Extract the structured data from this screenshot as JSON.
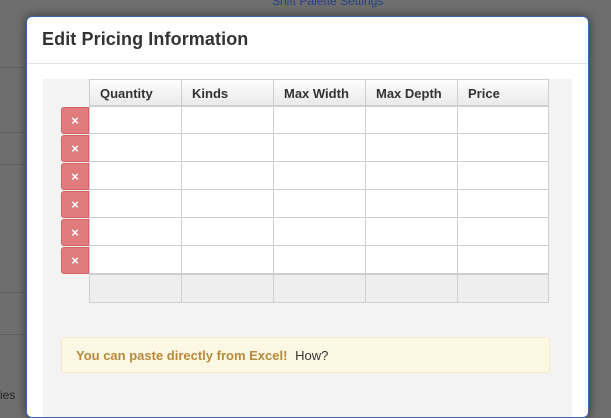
{
  "background": {
    "top_link": "Shift Palette Settings",
    "bottom_text": "ies"
  },
  "modal": {
    "title": "Edit Pricing Information"
  },
  "grid": {
    "columns": [
      "Quantity",
      "Kinds",
      "Max Width",
      "Max Depth",
      "Price"
    ],
    "row_count": 6,
    "delete_icon": "×",
    "rows": [
      [
        "",
        "",
        "",
        "",
        ""
      ],
      [
        "",
        "",
        "",
        "",
        ""
      ],
      [
        "",
        "",
        "",
        "",
        ""
      ],
      [
        "",
        "",
        "",
        "",
        ""
      ],
      [
        "",
        "",
        "",
        "",
        ""
      ],
      [
        "",
        "",
        "",
        "",
        ""
      ]
    ]
  },
  "tip": {
    "bold": "You can paste directly from Excel!",
    "link": "How?"
  },
  "colors": {
    "delete_button": "#e07c7e",
    "tip_background": "#fcf8e3",
    "tip_text": "#b8893c",
    "modal_border": "#3a66b3"
  }
}
